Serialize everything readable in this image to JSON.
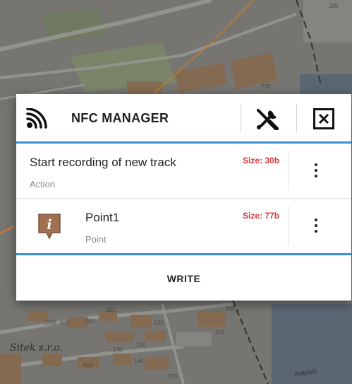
{
  "map": {
    "place_label": "Sitek s.r.o.",
    "street_label": "Nábřeží",
    "number_labels": [
      "335",
      "776",
      "142",
      "2269, 469",
      "402",
      "281",
      "133",
      "329",
      "130",
      "190",
      "614",
      "184",
      "743"
    ]
  },
  "dialog": {
    "title": "NFC MANAGER",
    "items": [
      {
        "title": "Start recording of new track",
        "type": "Action",
        "size": "Size: 30b"
      },
      {
        "title": "Point1",
        "type": "Point",
        "size": "Size: 77b"
      }
    ],
    "write_label": "WRITE"
  },
  "colors": {
    "accent_blue": "#3d8fd6",
    "size_red": "#d53a3a",
    "point_icon_brown": "#a07050"
  }
}
